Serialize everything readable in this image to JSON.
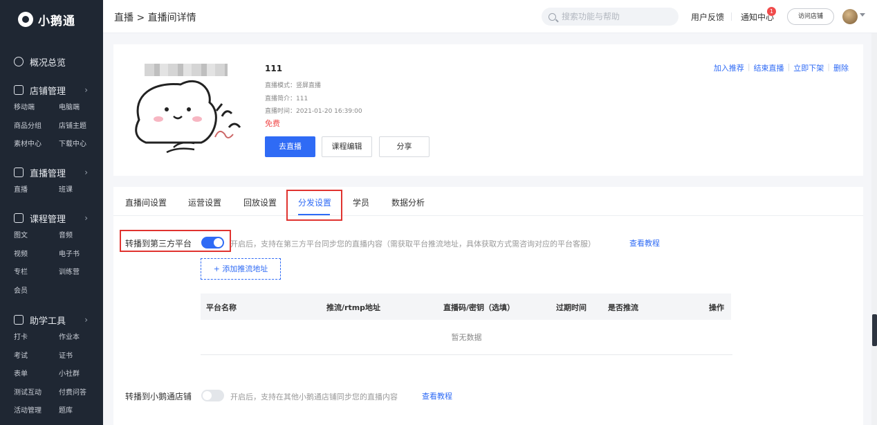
{
  "brand": {
    "name": "小鹅通"
  },
  "sidebar": {
    "groups": [
      {
        "label": "概况总览",
        "icon": "pie-chart-icon",
        "items": []
      },
      {
        "label": "店铺管理",
        "icon": "store-icon",
        "items": [
          "移动端",
          "电脑端",
          "商品分组",
          "店铺主题",
          "素材中心",
          "下载中心"
        ]
      },
      {
        "label": "直播管理",
        "icon": "camera-icon",
        "items": [
          "直播",
          "班课"
        ]
      },
      {
        "label": "课程管理",
        "icon": "book-icon",
        "items": [
          "图文",
          "音频",
          "视频",
          "电子书",
          "专栏",
          "训练营",
          "会员"
        ]
      },
      {
        "label": "助学工具",
        "icon": "toolbox-icon",
        "items": [
          "打卡",
          "作业本",
          "考试",
          "证书",
          "表单",
          "小社群",
          "测试互动",
          "付费问答",
          "活动管理",
          "题库"
        ]
      }
    ]
  },
  "header": {
    "breadcrumb": "直播 > 直播间详情",
    "search_placeholder": "搜索功能与帮助",
    "feedback": "用户反馈",
    "notifications": "通知中心",
    "notification_count": "1",
    "visit_store": "访问店铺"
  },
  "live": {
    "title": "111",
    "mode": "直播模式：竖屏直播",
    "intro": "直播简介：111",
    "time": "直播时间：2021-01-20 16:39:00",
    "price": "免费",
    "buttons": {
      "go_live": "去直播",
      "edit_course": "课程编辑",
      "share": "分享"
    },
    "ops": [
      "加入推荐",
      "结束直播",
      "立即下架",
      "删除"
    ]
  },
  "tabs": [
    "直播间设置",
    "运营设置",
    "回放设置",
    "分发设置",
    "学员",
    "数据分析"
  ],
  "active_tab": "分发设置",
  "third_party": {
    "label": "转播到第三方平台",
    "enabled": true,
    "desc": "开启后，支持在第三方平台同步您的直播内容（需获取平台推流地址，具体获取方式需咨询对应的平台客服）",
    "tutorial": "查看教程",
    "add_button": "+ 添加推流地址",
    "columns": [
      "平台名称",
      "推流/rtmp地址",
      "直播码/密钥（选填）",
      "过期时间",
      "是否推流",
      "操作"
    ],
    "empty_text": "暂无数据"
  },
  "xiaoe_store": {
    "label": "转播到小鹅通店铺",
    "enabled": false,
    "desc": "开启后，支持在其他小鹅通店铺同步您的直播内容",
    "tutorial": "查看教程"
  },
  "colors": {
    "accent": "#2f6bf5",
    "sidebar_bg": "#1f2733",
    "highlight_border": "#e0332f",
    "price": "#f04b4b"
  }
}
